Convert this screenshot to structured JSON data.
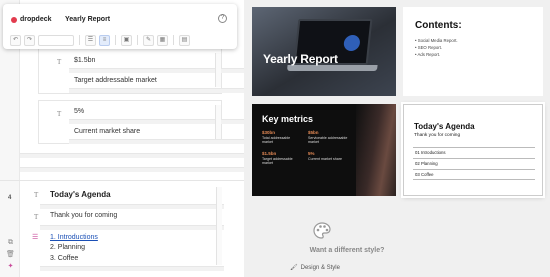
{
  "app": {
    "brand": "dropdeck",
    "document_title": "Yearly Report",
    "help_glyph": "?"
  },
  "toolbar": {
    "undo_glyph": "↶",
    "redo_glyph": "↷",
    "buttons": [
      "☰",
      "≡",
      "▣",
      "✎",
      "▦",
      "▤"
    ]
  },
  "editor": {
    "metric1": {
      "value": "$1.5bn",
      "label": "Target addressable market"
    },
    "metric2": {
      "value": "5%",
      "label": "Current market share"
    },
    "slide_number": "4",
    "agenda_title": "Today's Agenda",
    "agenda_subtitle": "Thank you for coming",
    "agenda_items": [
      "1. Introductions",
      "2. Planning",
      "3. Coffee"
    ]
  },
  "preview": {
    "slide1": {
      "title": "Yearly Report"
    },
    "slide2": {
      "heading": "Contents:",
      "items": [
        "Social Media Report.",
        "SEO Report.",
        "Ads Report."
      ]
    },
    "slide3": {
      "heading": "Key metrics",
      "metrics": [
        {
          "value": "$30bn",
          "label": "Total addressable market"
        },
        {
          "value": "$5bn",
          "label": "Serviceable addressable market"
        },
        {
          "value": "$1.5bn",
          "label": "Target addressable market"
        },
        {
          "value": "5%",
          "label": "Current market share"
        }
      ]
    },
    "slide4": {
      "heading": "Today's Agenda",
      "sub": "Thank you for coming",
      "items": [
        "01  Introductions",
        "02  Planning",
        "03  Coffee"
      ]
    },
    "want_style": "Want a different style?",
    "design_style": "Design & Style"
  },
  "colors": {
    "brand": "#e23b4e",
    "accent_orange": "#e58a55",
    "link": "#1a4fb5"
  }
}
